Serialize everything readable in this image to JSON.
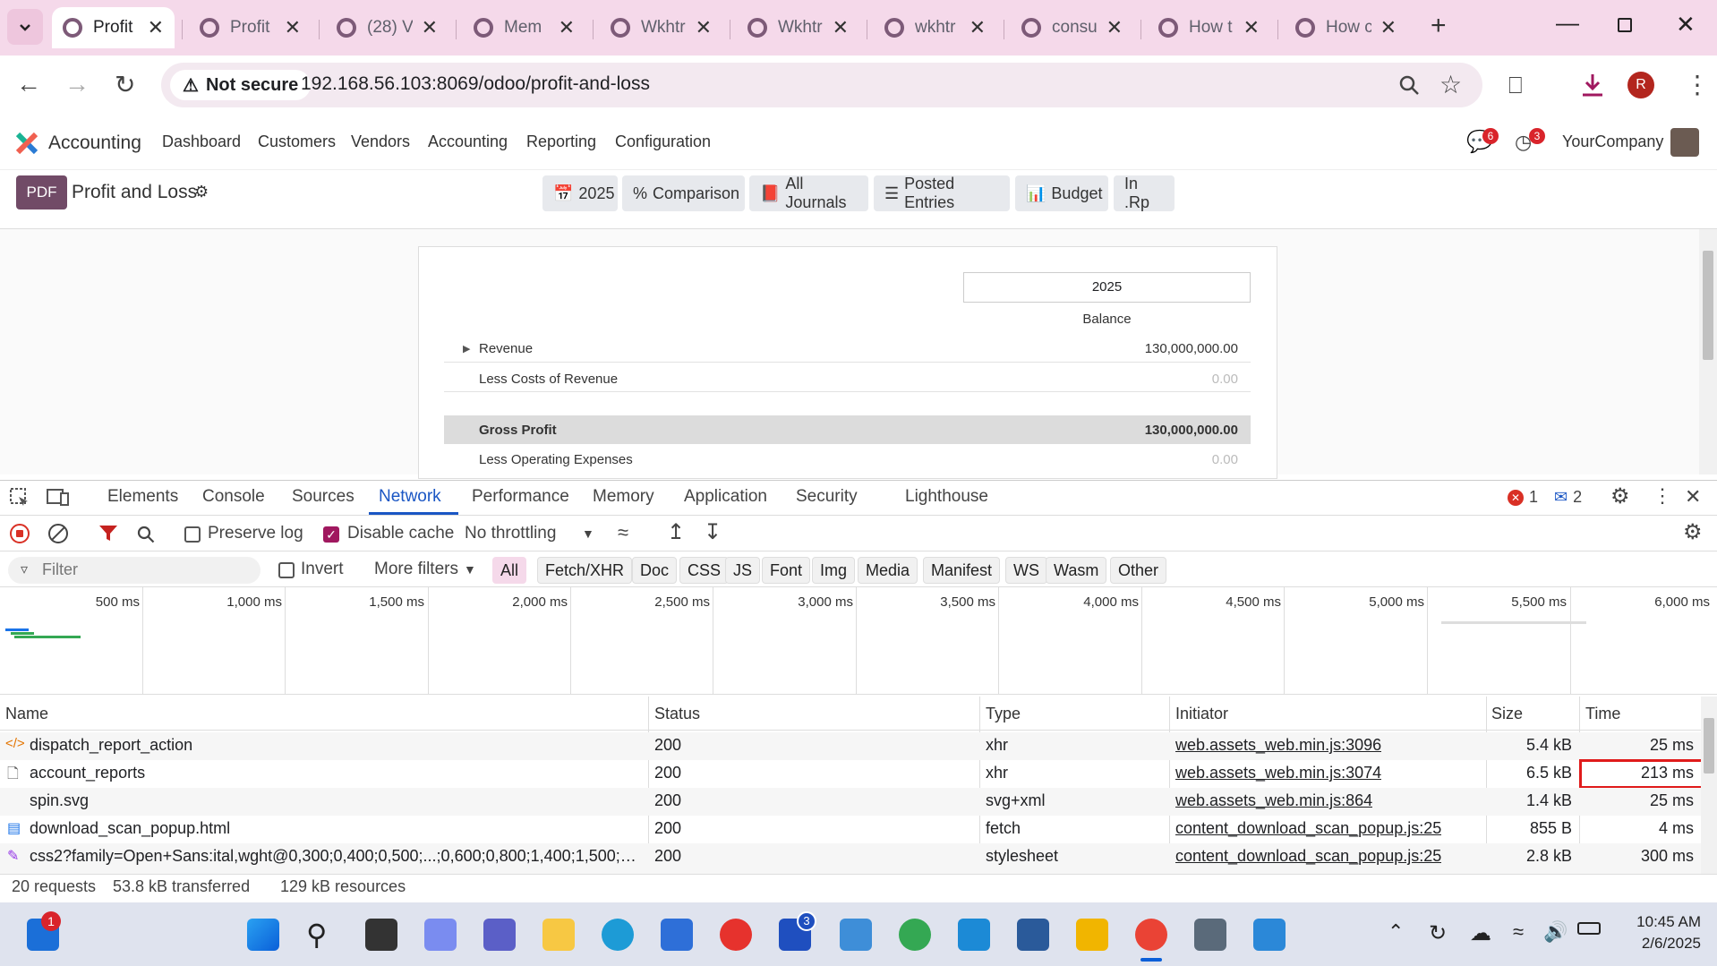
{
  "browser": {
    "tabs": [
      {
        "label": "Profit",
        "active": true
      },
      {
        "label": "Profit",
        "active": false
      },
      {
        "label": "(28) V",
        "active": false
      },
      {
        "label": "Mem",
        "active": false
      },
      {
        "label": "Wkhtr",
        "active": false
      },
      {
        "label": "Wkhtr",
        "active": false
      },
      {
        "label": "wkhtr",
        "active": false
      },
      {
        "label": "consu",
        "active": false
      },
      {
        "label": "How t",
        "active": false
      },
      {
        "label": "How c",
        "active": false
      }
    ],
    "security_label": "Not secure",
    "url": "192.168.56.103:8069/odoo/profit-and-loss",
    "profile_initial": "R"
  },
  "odoo": {
    "app_name": "Accounting",
    "menu": [
      "Dashboard",
      "Customers",
      "Vendors",
      "Accounting",
      "Reporting",
      "Configuration"
    ],
    "messages_badge": "6",
    "activities_badge": "3",
    "company": "YourCompany",
    "pdf_label": "PDF",
    "page_title": "Profit and Loss",
    "filters": [
      "2025",
      "Comparison",
      "All Journals",
      "Posted Entries",
      "Budget",
      "In .Rp"
    ]
  },
  "report": {
    "period": "2025",
    "column_label": "Balance",
    "lines": [
      {
        "label": "Revenue",
        "value": "130,000,000.00"
      },
      {
        "label": "Less Costs of Revenue",
        "value": "0.00"
      },
      {
        "label": "Gross Profit",
        "value": "130,000,000.00"
      },
      {
        "label": "Less Operating Expenses",
        "value": "0.00"
      }
    ]
  },
  "devtools": {
    "tabs": [
      "Elements",
      "Console",
      "Sources",
      "Network",
      "Performance",
      "Memory",
      "Application",
      "Security",
      "Lighthouse"
    ],
    "active_tab": "Network",
    "error_count": "1",
    "message_count": "2",
    "preserve_log": "Preserve log",
    "disable_cache": "Disable cache",
    "throttling": "No throttling",
    "filter_placeholder": "Filter",
    "invert": "Invert",
    "more_filters": "More filters",
    "type_filters": [
      "All",
      "Fetch/XHR",
      "Doc",
      "CSS",
      "JS",
      "Font",
      "Img",
      "Media",
      "Manifest",
      "WS",
      "Wasm",
      "Other"
    ],
    "timeline_ticks": [
      "500 ms",
      "1,000 ms",
      "1,500 ms",
      "2,000 ms",
      "2,500 ms",
      "3,000 ms",
      "3,500 ms",
      "4,000 ms",
      "4,500 ms",
      "5,000 ms",
      "5,500 ms",
      "6,000 ms"
    ],
    "columns": [
      "Name",
      "Status",
      "Type",
      "Initiator",
      "Size",
      "Time"
    ],
    "rows": [
      {
        "name": "dispatch_report_action",
        "status": "200",
        "type": "xhr",
        "initiator": "web.assets_web.min.js:3096",
        "size": "5.4 kB",
        "time": "25 ms"
      },
      {
        "name": "account_reports",
        "status": "200",
        "type": "xhr",
        "initiator": "web.assets_web.min.js:3074",
        "size": "6.5 kB",
        "time": "213 ms"
      },
      {
        "name": "spin.svg",
        "status": "200",
        "type": "svg+xml",
        "initiator": "web.assets_web.min.js:864",
        "size": "1.4 kB",
        "time": "25 ms"
      },
      {
        "name": "download_scan_popup.html",
        "status": "200",
        "type": "fetch",
        "initiator": "content_download_scan_popup.js:25",
        "size": "855 B",
        "time": "4 ms"
      },
      {
        "name": "css2?family=Open+Sans:ital,wght@0,300;0,400;0,500;...;0,600;0,800;1,400;1,500;1,600...",
        "status": "200",
        "type": "stylesheet",
        "initiator": "content_download_scan_popup.js:25",
        "size": "2.8 kB",
        "time": "300 ms"
      }
    ],
    "summary": {
      "requests": "20 requests",
      "transferred": "53.8 kB transferred",
      "resources": "129 kB resources"
    }
  },
  "taskbar": {
    "mail_badge": "1",
    "l_badge": "3",
    "time": "10:45 AM",
    "date": "2/6/2025"
  }
}
